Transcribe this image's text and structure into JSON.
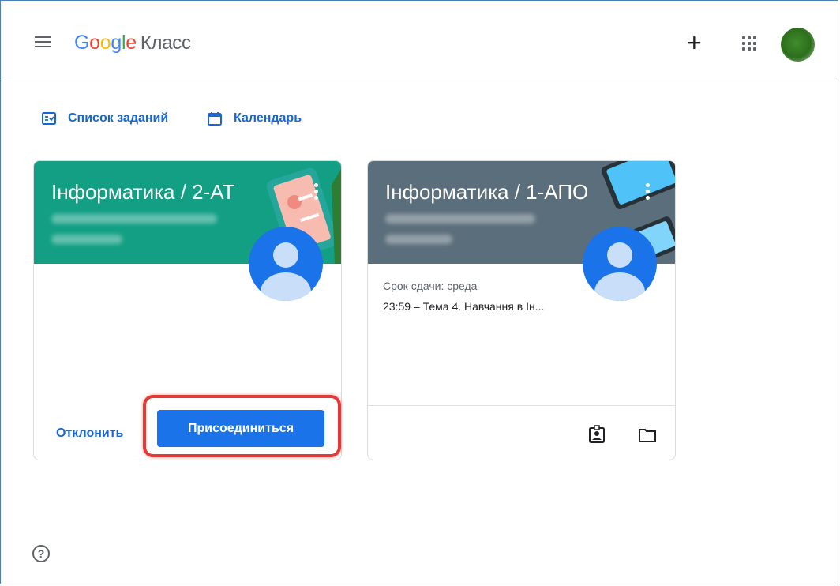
{
  "header": {
    "logo": {
      "G": "G",
      "o1": "o",
      "o2": "o",
      "g": "g",
      "l": "l",
      "e": "e"
    },
    "app_name": "Класс",
    "icons": {
      "menu": "menu-icon",
      "add": "plus-icon",
      "apps": "apps-grid-icon",
      "account": "avatar"
    }
  },
  "nav": {
    "todo_label": "Список заданий",
    "calendar_label": "Календарь"
  },
  "cards": [
    {
      "title": "Інформатика / 2-АТ",
      "header_color": "#129f84",
      "decline_label": "Отклонить",
      "join_label": "Присоединиться"
    },
    {
      "title": "Інформатика / 1-АПО",
      "header_color": "#5b6e7b",
      "due_label": "Срок сдачи: среда",
      "due_item": "23:59 – Тема 4. Навчання в Ін..."
    }
  ],
  "help": {
    "label": "?"
  },
  "colors": {
    "accent": "#1a73e8",
    "highlight": "#e53935"
  }
}
